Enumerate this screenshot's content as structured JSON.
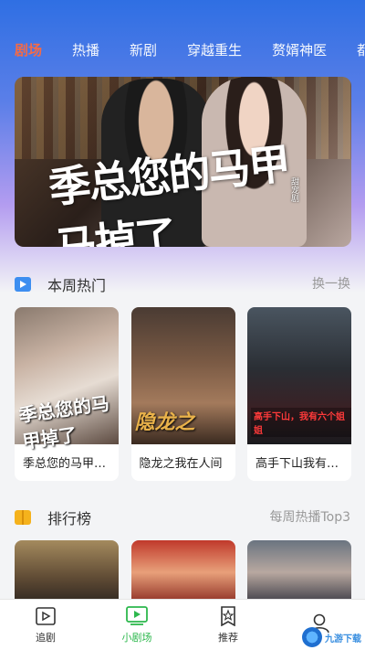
{
  "tabs": [
    {
      "label": "剧场",
      "active": true
    },
    {
      "label": "热播",
      "active": false
    },
    {
      "label": "新剧",
      "active": false
    },
    {
      "label": "穿越重生",
      "active": false
    },
    {
      "label": "赘婿神医",
      "active": false
    },
    {
      "label": "都",
      "active": false
    }
  ],
  "banner": {
    "title_art": "季总您的马甲 马掉了",
    "tag": "甜宠剧"
  },
  "weekly_hot": {
    "title": "本周热门",
    "more": "换一换",
    "icon": "play-square-icon",
    "icon_color": "#3d8ef0",
    "items": [
      {
        "title": "季总您的马甲掉了",
        "poster_text": "季总您的马甲掉了"
      },
      {
        "title": "隐龙之我在人间",
        "poster_text": "隐龙之"
      },
      {
        "title": "高手下山我有六个姐姐",
        "poster_text": "高手下山，我有六个姐姐"
      }
    ]
  },
  "ranking": {
    "title": "排行榜",
    "more": "每周热播Top3",
    "icon": "book-icon",
    "icon_color": "#f5b21c"
  },
  "bottom_nav": [
    {
      "label": "追剧",
      "icon": "play-box-icon",
      "active": false
    },
    {
      "label": "小剧场",
      "icon": "tv-play-icon",
      "active": true
    },
    {
      "label": "推荐",
      "icon": "star-badge-icon",
      "active": false
    },
    {
      "label": "",
      "icon": "user-icon",
      "active": false
    }
  ],
  "watermark": {
    "text": "九游下载"
  },
  "colors": {
    "accent_active_tab": "#ff6a3d",
    "nav_active": "#2db84d"
  }
}
